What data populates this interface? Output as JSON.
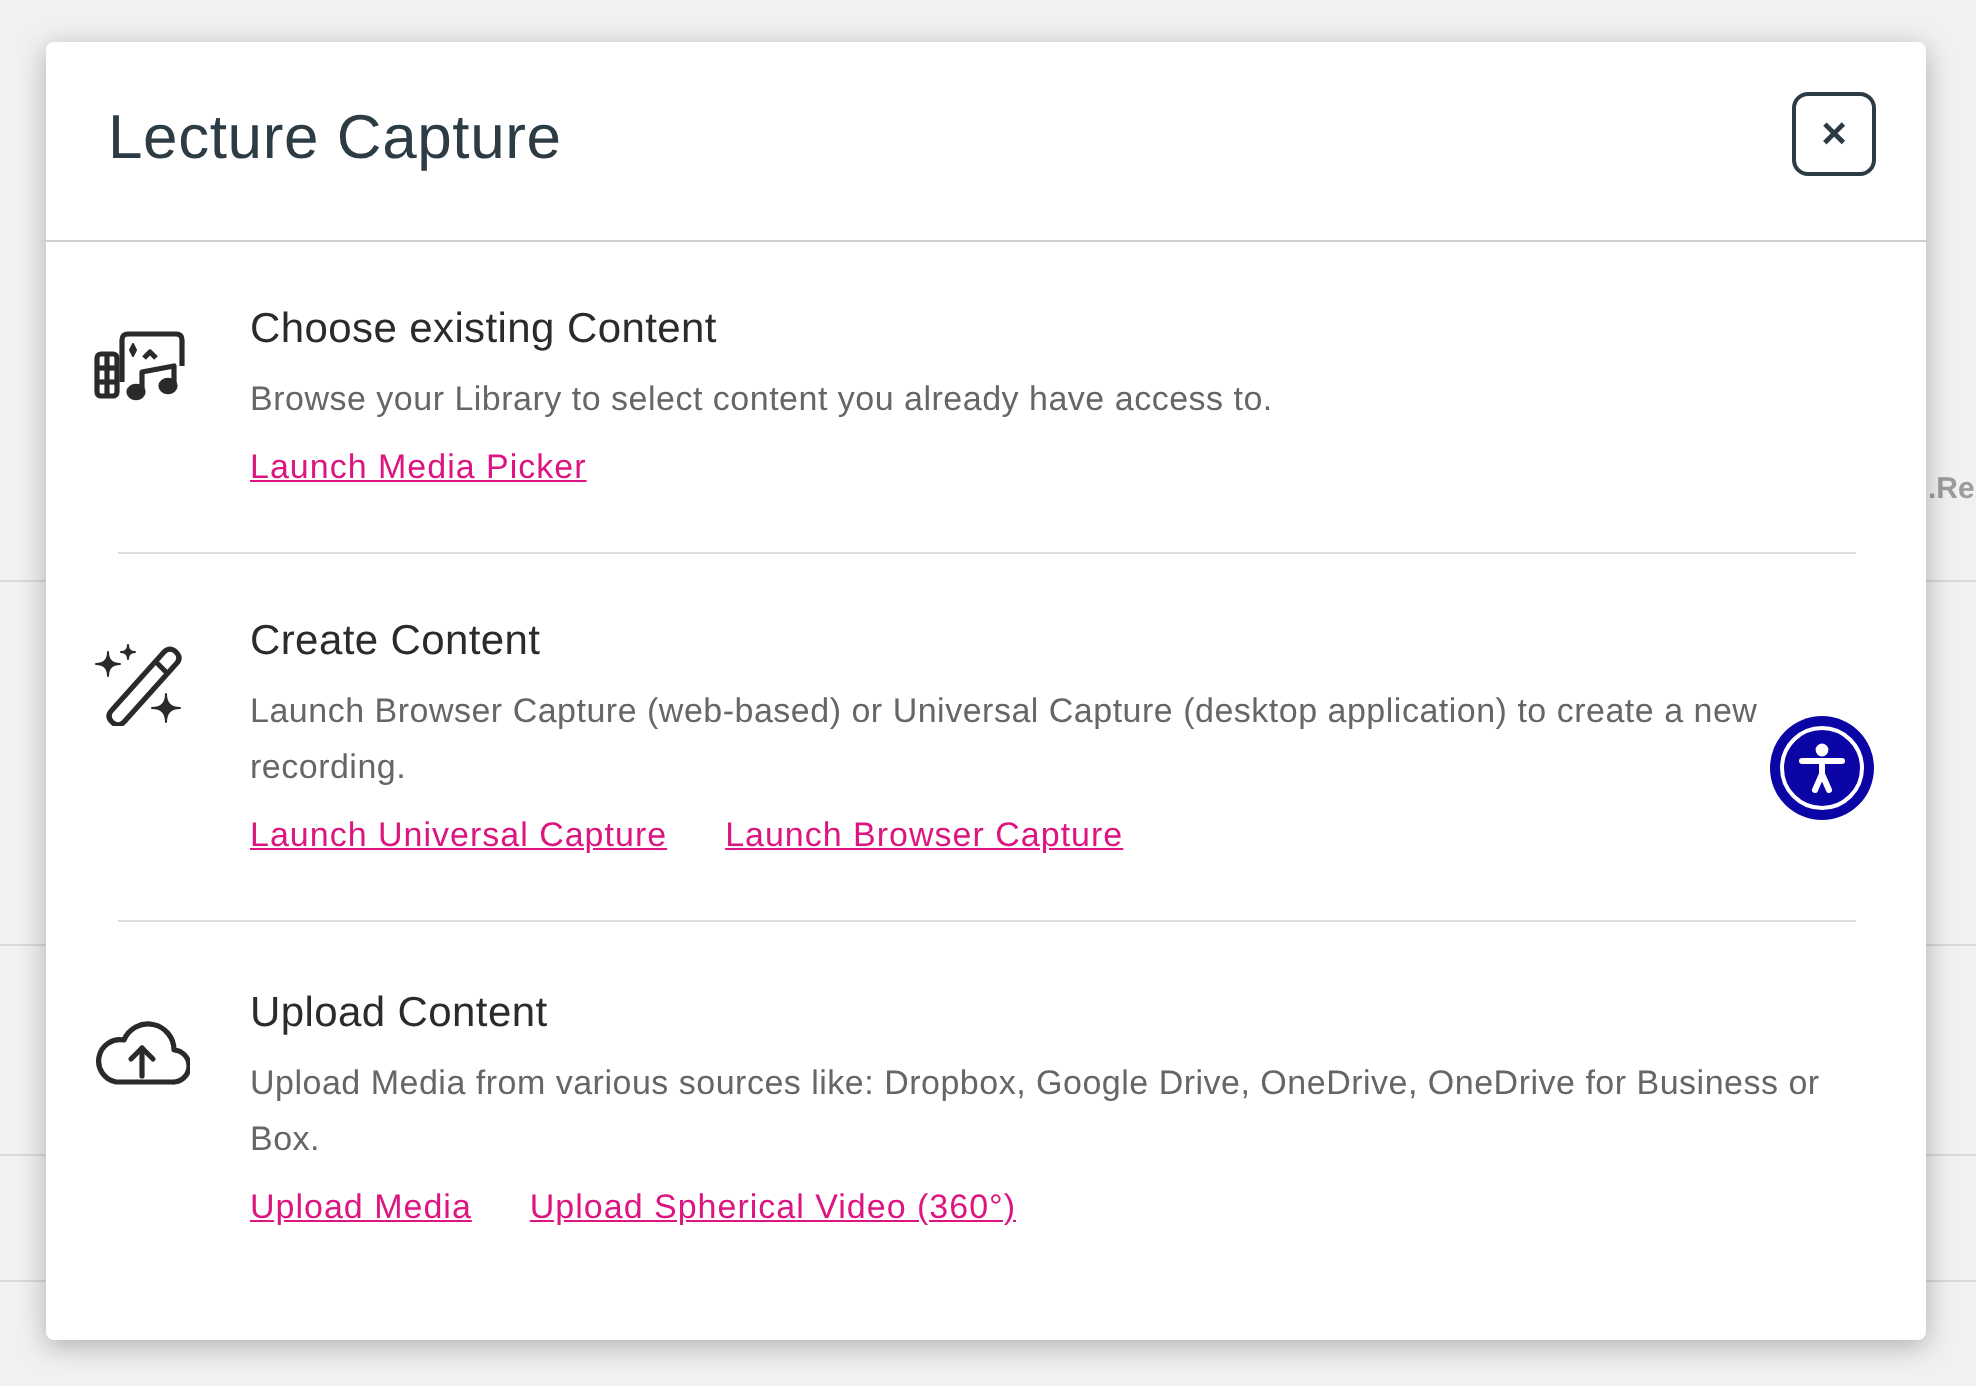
{
  "background_page": {
    "side_text": ".Re"
  },
  "dialog": {
    "title": "Lecture Capture",
    "close_button": "×"
  },
  "sections": [
    {
      "kind": "library",
      "title": "Choose existing Content",
      "description": "Browse your Library to select content you already have access to.",
      "links": [
        "Launch Media Picker"
      ]
    },
    {
      "kind": "create",
      "title": "Create Content",
      "description": "Launch Browser Capture (web-based) or Universal Capture (desktop application) to create a new recording.",
      "links": [
        "Launch Universal Capture",
        "Launch Browser Capture"
      ]
    },
    {
      "kind": "upload",
      "title": "Upload Content",
      "description": "Upload Media from various sources like: Dropbox, Google Drive, OneDrive, OneDrive for Business or Box.",
      "links": [
        "Upload Media",
        "Upload Spherical Video (360°)"
      ]
    }
  ]
}
